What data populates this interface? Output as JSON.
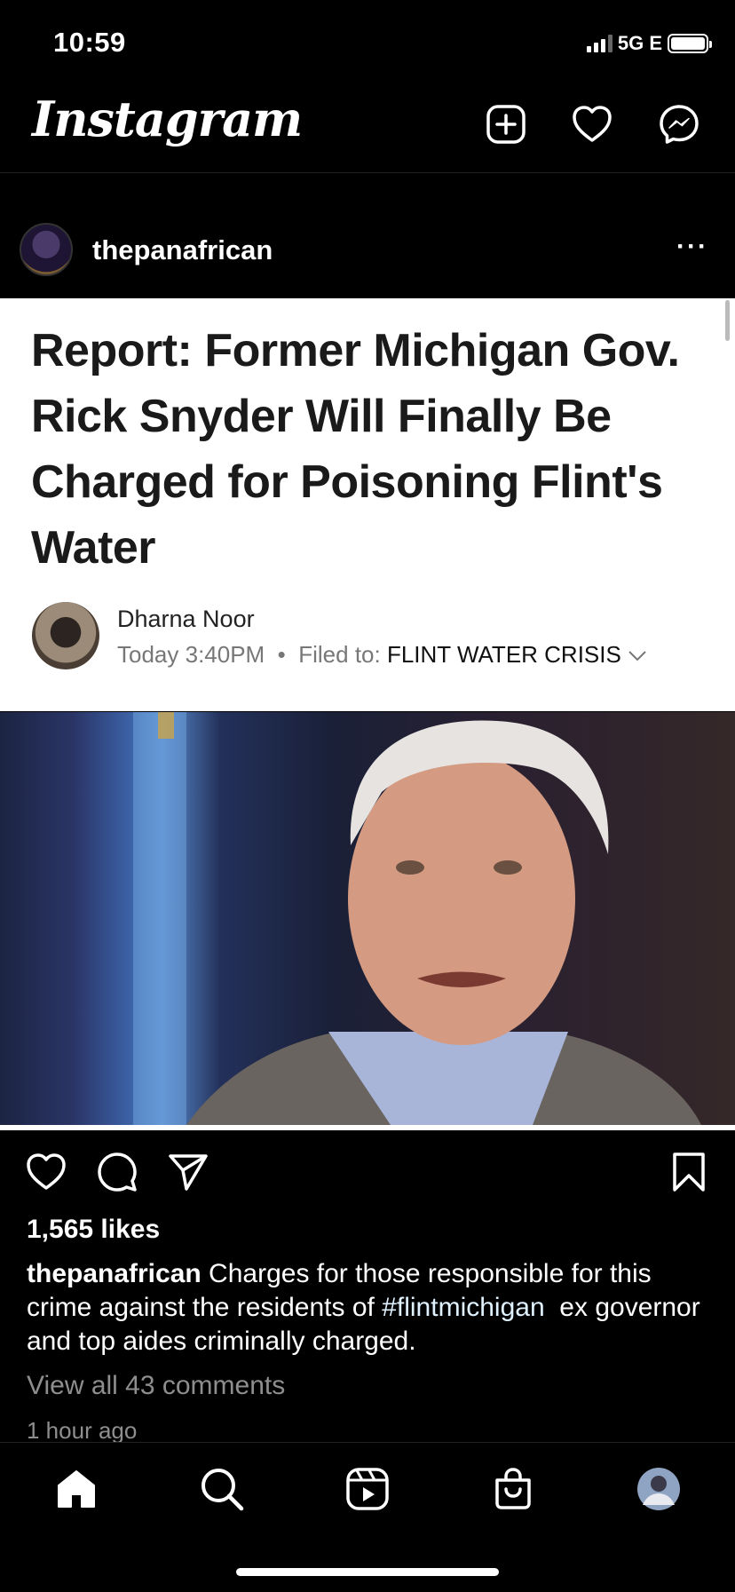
{
  "status_bar": {
    "time": "10:59",
    "network": "5G E"
  },
  "header": {
    "logo": "Instagram"
  },
  "post": {
    "username": "thepanafrican",
    "more": "···",
    "article": {
      "headline": "Report: Former Michigan Gov. Rick Snyder Will Finally Be Charged for Poisoning Flint's Water",
      "author": "Dharna Noor",
      "time": "Today 3:40PM",
      "separator": "•",
      "filed_label": "Filed to:",
      "filed_tag": "FLINT WATER CRISIS"
    },
    "likes": "1,565 likes",
    "caption": {
      "username": "thepanafrican",
      "text_before": " Charges for those responsible for this crime against the residents of ",
      "hashtag": "#flintmichigan",
      "text_after": "  ex governor and top aides criminally charged."
    },
    "view_comments": "View all 43 comments",
    "time_ago": "1 hour ago"
  },
  "icons": {
    "header": [
      "new-post-icon",
      "heart-icon",
      "messenger-icon"
    ],
    "actions": [
      "like-icon",
      "comment-icon",
      "share-icon",
      "save-icon"
    ],
    "nav": [
      "home-icon",
      "search-icon",
      "reels-icon",
      "shop-icon",
      "profile-avatar"
    ]
  }
}
